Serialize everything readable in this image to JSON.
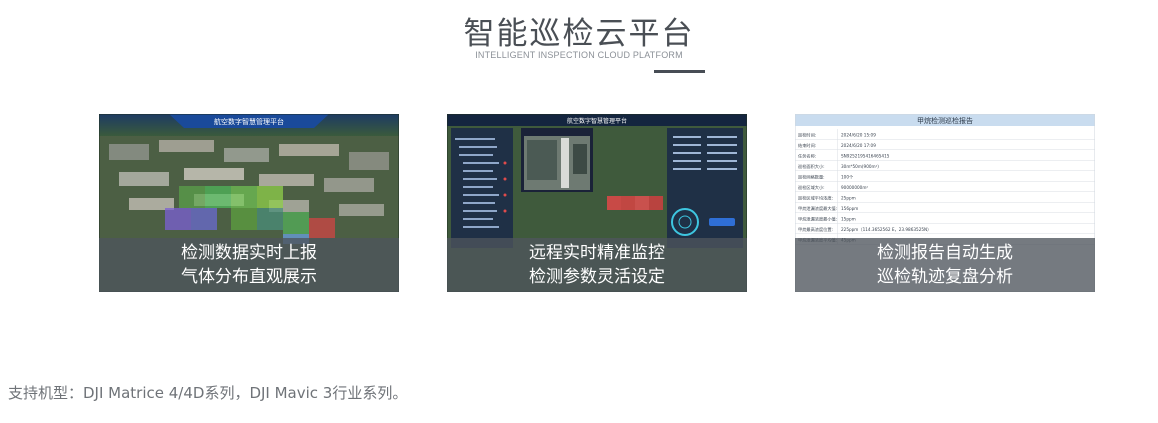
{
  "header": {
    "title": "智能巡检云平台",
    "subtitle": "INTELLIGENT INSPECTION CLOUD PLATFORM"
  },
  "cards": [
    {
      "screen_title": "航空数字智慧管理平台",
      "line1": "检测数据实时上报",
      "line2": "气体分布直观展示"
    },
    {
      "screen_title": "航空数字智慧管理平台",
      "line1": "远程实时精准监控",
      "line2": "检测参数灵活设定"
    },
    {
      "screen_title": "甲烷检测巡检报告",
      "report_rows": [
        [
          "巡检时间:",
          "2024/6/20 15:09"
        ],
        [
          "结束时间:",
          "2024/6/20 17:09"
        ],
        [
          "任务名称:",
          "SN9252195416465415"
        ],
        [
          "巡检面积大小:",
          "30m*50m(900m²)"
        ],
        [
          "巡检网格数量:",
          "100个"
        ],
        [
          "巡检区域大小:",
          "90000000m²"
        ],
        [
          "巡检区域平均浓度:",
          "25ppm"
        ],
        [
          "甲烷泄漏浓度最大值:",
          "156ppm"
        ],
        [
          "甲烷泄漏浓度最小值:",
          "15ppm"
        ],
        [
          "甲烷最高浓度位置:",
          "225ppm（114.3652562 E，23.9863525N）"
        ],
        [
          "甲烷泄漏浓度平均值:",
          "45ppm"
        ]
      ],
      "line1": "检测报告自动生成",
      "line2": "巡检轨迹复盘分析"
    }
  ],
  "footnote": "支持机型：DJI Matrice 4/4D系列，DJI Mavic 3行业系列。",
  "colors": {
    "title": "#4a4f55",
    "subtitle": "#8b9097",
    "caption_bg": "#4e545c",
    "report_header": "#c9dcef"
  }
}
